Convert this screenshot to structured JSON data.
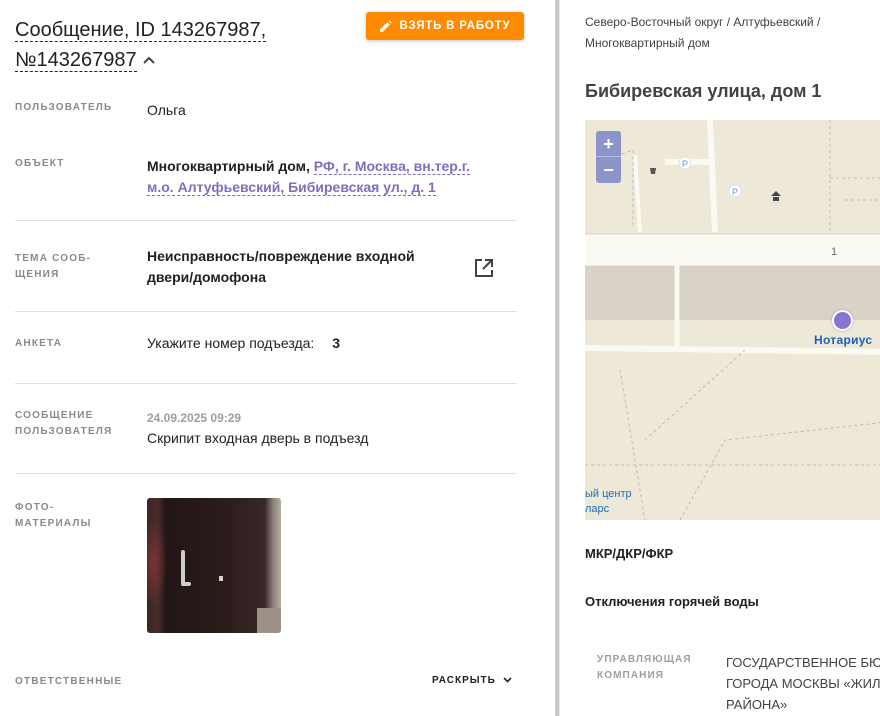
{
  "message": {
    "title": "Сообщение, ID 143267987, №143267987",
    "take_button": "ВЗЯТЬ В РАБОТУ"
  },
  "fields": {
    "user_label": "ПОЛЬЗОВАТЕЛЬ",
    "user_value": "Ольга",
    "object_label": "ОБЪЕКТ",
    "object_type": "Многоквартирный дом, ",
    "object_address": "РФ, г. Москва, вн.тер.г. м.о. Алтуфьевский, Бибиревская ул., д. 1",
    "topic_label": "ТЕМА СООБ-ЩЕНИЯ",
    "topic_value": "Неисправность/повреждение входной двери/домофона",
    "survey_label": "АНКЕТА",
    "survey_question": "Укажите номер подъезда:",
    "survey_answer": "3",
    "user_msg_label": "СООБЩЕНИЕ ПОЛЬЗОВАТЕЛЯ",
    "user_msg_time": "24.09.2025 09:29",
    "user_msg_text": "Скрипит входная дверь в подъезд",
    "photos_label": "ФОТО-МАТЕРИАЛЫ",
    "responsible_label": "ОТВЕТСТВЕННЫЕ",
    "expand_label": "РАСКРЫТЬ"
  },
  "right": {
    "breadcrumb": "Северо-Восточный округ / Алтуфьевский / Многоквартирный дом",
    "address": "Бибиревская улица, дом 1",
    "map": {
      "zoom_in": "+",
      "zoom_out": "−",
      "poi_notary": "Нотариус",
      "house_number": "1",
      "partial_label_1": "ый центр",
      "partial_label_2": "ларс",
      "parking": "P",
      "small_label": "5"
    },
    "mkr": "МКР/ДКР/ФКР",
    "hot_water": "Отключения горячей воды",
    "mc_label": "УПРАВЛЯЮЩАЯ КОМПАНИЯ",
    "mc_value": "ГОСУДАРСТВЕННОЕ БЮ ГОРОДА МОСКВЫ «ЖИЛ РАЙОНА»"
  },
  "colors": {
    "accent_orange": "#ff8a00",
    "link_purple": "#7c6fbf",
    "map_bg": "#ede8d8"
  }
}
